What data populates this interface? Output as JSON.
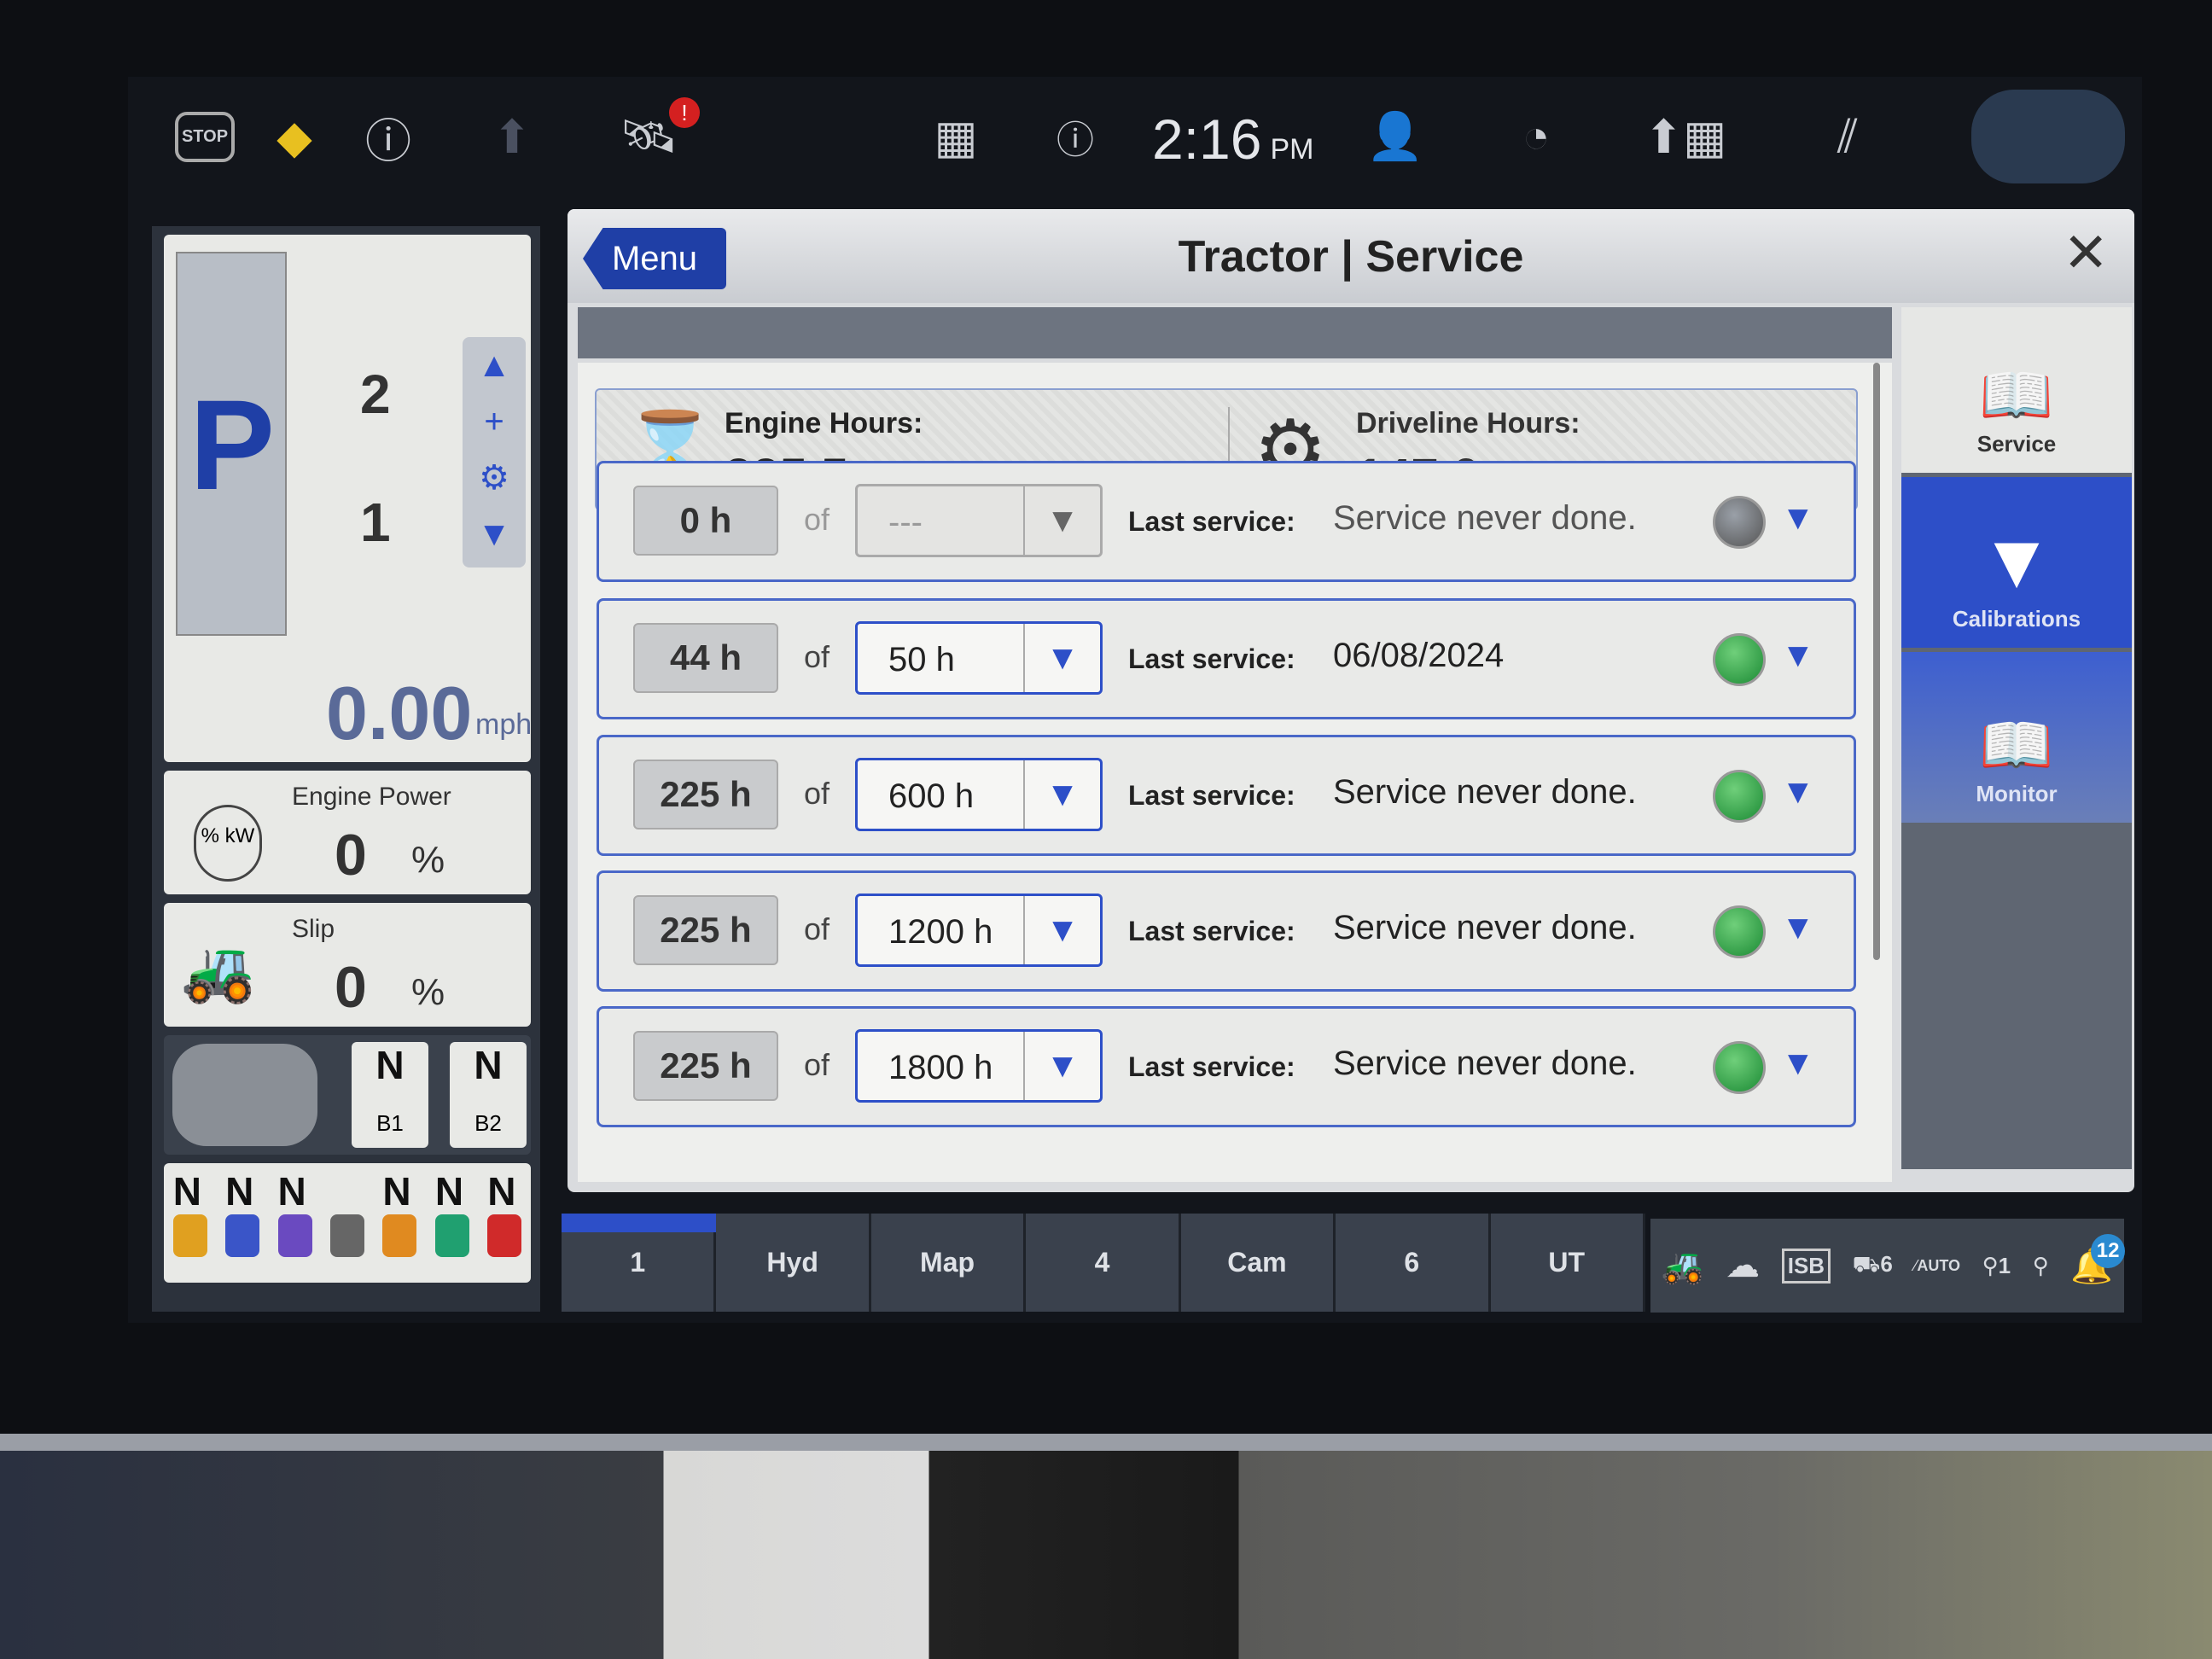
{
  "topbar": {
    "stop_label": "STOP",
    "time": "2:16",
    "ampm": "PM",
    "gps_alert": "!"
  },
  "left": {
    "gear": "P",
    "ranges": [
      "2",
      "1"
    ],
    "speed": "0.00",
    "speed_unit": "mph",
    "engine_power_label": "Engine Power",
    "engine_power_icon": "% kW",
    "engine_power_value": "0",
    "engine_power_unit": "%",
    "slip_label": "Slip",
    "slip_value": "0",
    "slip_unit": "%",
    "remotes": [
      {
        "state": "N",
        "label": "B1"
      },
      {
        "state": "N",
        "label": "B2"
      }
    ],
    "valves": [
      "N",
      "N",
      "N",
      "N",
      "N",
      "N"
    ],
    "valve_colors": [
      "#e0a020",
      "#3a55c8",
      "#6a4ac0",
      "#888888",
      "#e08a20",
      "#20a070",
      "#d02a2a"
    ]
  },
  "dialog": {
    "menu_label": "Menu",
    "title": "Tractor | Service",
    "engine_hours_label": "Engine Hours:",
    "engine_hours": "225.5",
    "driveline_hours_label": "Driveline Hours:",
    "driveline_hours": "147.0",
    "of_label": "of",
    "last_service_label": "Last service:",
    "rows": [
      {
        "current": "0 h",
        "interval": "---",
        "last": "Service never done.",
        "status": "gray"
      },
      {
        "current": "44 h",
        "interval": "50 h",
        "last": "06/08/2024",
        "status": "green"
      },
      {
        "current": "225 h",
        "interval": "600 h",
        "last": "Service never done.",
        "status": "green"
      },
      {
        "current": "225 h",
        "interval": "1200 h",
        "last": "Service never done.",
        "status": "green"
      },
      {
        "current": "225 h",
        "interval": "1800 h",
        "last": "Service never done.",
        "status": "green"
      }
    ],
    "side": [
      {
        "label": "Service"
      },
      {
        "label": "Calibrations"
      },
      {
        "label": "Monitor"
      }
    ]
  },
  "tabs": [
    "1",
    "Hyd",
    "Map",
    "4",
    "Cam",
    "6",
    "UT"
  ],
  "status": {
    "isb": "ISB",
    "implement_count": "6",
    "auto": "AUTO",
    "remote_count": "1",
    "notifications": "12"
  },
  "colors": {
    "accent": "#2d4fc8",
    "menu": "#1f3fa6",
    "led_green": "#1b8a34"
  }
}
